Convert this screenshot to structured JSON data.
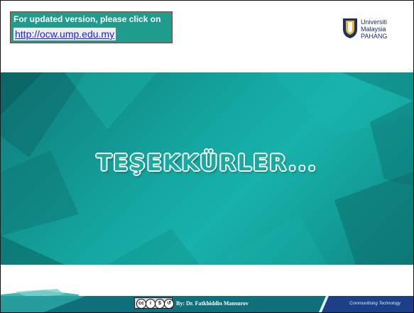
{
  "header": {
    "update_text": "For updated version, please click on",
    "update_link": "http://ocw.ump.edu.my",
    "logo": {
      "line1": "Universiti",
      "line2": "Malaysia",
      "line3": "PAHANG",
      "icon": "university-shield-icon"
    }
  },
  "banner": {
    "title": "TEŞEKKÜRLER..."
  },
  "footer": {
    "author": "By: Dr. Fatkhiddin Mansurov",
    "tagline": "Communitising Technology",
    "license_icon": "cc-by-nc-sa-icon"
  },
  "colors": {
    "teal": "#14a7a1",
    "dark_teal": "#0e7f7d",
    "navy": "#1a2f6e",
    "link": "#1a1aff"
  }
}
